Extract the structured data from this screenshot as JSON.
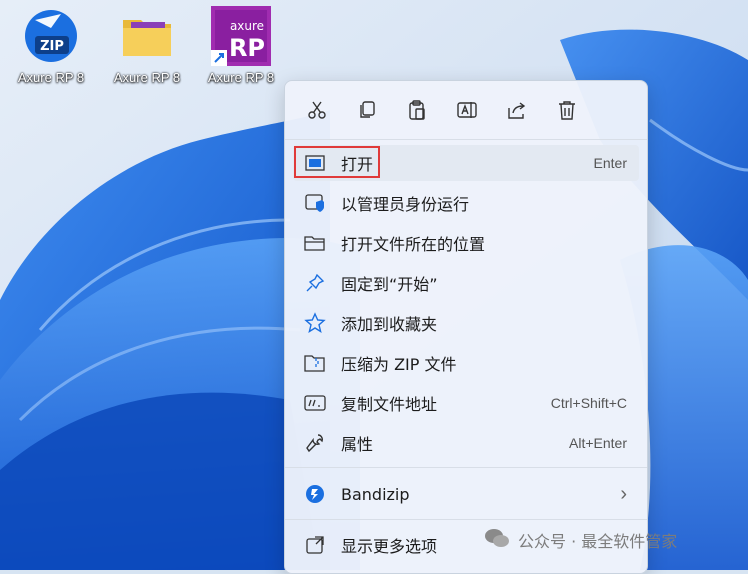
{
  "desktop": {
    "icons": [
      {
        "label": "Axure RP 8",
        "icon": "zip-icon"
      },
      {
        "label": "Axure RP 8",
        "icon": "folder-icon"
      },
      {
        "label": "Axure RP 8",
        "icon": "axure-rp-icon",
        "logo_text": "axure RP"
      }
    ]
  },
  "context_menu": {
    "toolbar": [
      "cut-icon",
      "copy-icon",
      "paste-icon",
      "rename-icon",
      "share-icon",
      "delete-icon"
    ],
    "items": [
      {
        "label": "打开",
        "shortcut": "Enter",
        "icon": "open-icon"
      },
      {
        "label": "以管理员身份运行",
        "shortcut": "",
        "icon": "run-as-admin-icon"
      },
      {
        "label": "打开文件所在的位置",
        "shortcut": "",
        "icon": "folder-open-icon"
      },
      {
        "label": "固定到“开始”",
        "shortcut": "",
        "icon": "pin-icon"
      },
      {
        "label": "添加到收藏夹",
        "shortcut": "",
        "icon": "star-icon"
      },
      {
        "label": "压缩为 ZIP 文件",
        "shortcut": "",
        "icon": "zip-compress-icon"
      },
      {
        "label": "复制文件地址",
        "shortcut": "Ctrl+Shift+C",
        "icon": "copy-path-icon"
      },
      {
        "label": "属性",
        "shortcut": "Alt+Enter",
        "icon": "wrench-icon"
      },
      {
        "label": "Bandizip",
        "shortcut": "",
        "icon": "bandizip-icon",
        "submenu": true
      },
      {
        "label": "显示更多选项",
        "shortcut": "",
        "icon": "more-options-icon"
      }
    ],
    "submenu_glyph": "›"
  },
  "watermark": {
    "text": "公众号 · 最全软件管家"
  },
  "colors": {
    "highlight_border": "#e03a3a",
    "wallpaper_blue": "#1e6bd8",
    "menu_bg": "#eef3fb"
  }
}
